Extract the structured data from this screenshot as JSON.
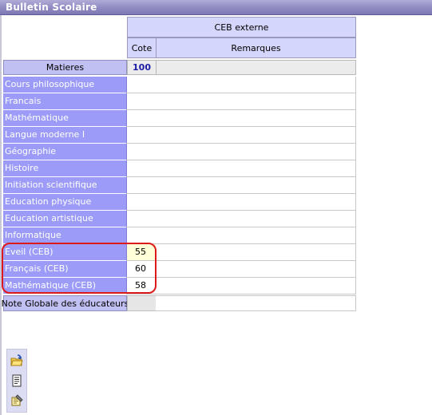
{
  "window": {
    "title": "Bulletin Scolaire"
  },
  "table": {
    "group_header": "CEB externe",
    "col_cote": "Cote",
    "col_remarques": "Remarques",
    "matieres_header": "Matieres",
    "max_points": "100",
    "rows": [
      {
        "subject": "Cours philosophique",
        "cote": ""
      },
      {
        "subject": "Francais",
        "cote": ""
      },
      {
        "subject": "Mathématique",
        "cote": ""
      },
      {
        "subject": "Langue moderne I",
        "cote": ""
      },
      {
        "subject": "Géographie",
        "cote": ""
      },
      {
        "subject": "Histoire",
        "cote": ""
      },
      {
        "subject": "Initiation scientifique",
        "cote": ""
      },
      {
        "subject": "Education physique",
        "cote": ""
      },
      {
        "subject": "Education artistique",
        "cote": ""
      },
      {
        "subject": "Informatique",
        "cote": ""
      },
      {
        "subject": "Eveil (CEB)",
        "cote": "55"
      },
      {
        "subject": "Français (CEB)",
        "cote": "60"
      },
      {
        "subject": "Mathématique (CEB)",
        "cote": "58"
      }
    ],
    "note_globale_label": "Note Globale des éducateurs"
  },
  "toolbar": {
    "buttons": [
      "open-folder-icon",
      "report-icon",
      "settings-icon"
    ]
  },
  "colors": {
    "subject_bg": "#9c9cf8",
    "header_bg": "#d5d6fb",
    "highlight": "#dc1a1a"
  }
}
